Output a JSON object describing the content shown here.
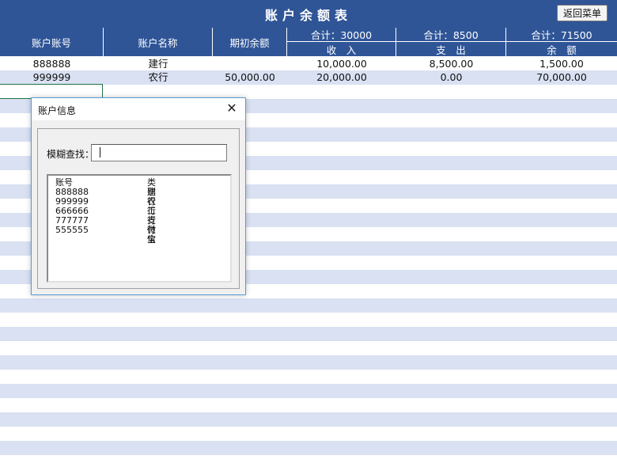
{
  "header": {
    "title": "账户余额表",
    "back_button": "返回菜单"
  },
  "columns": {
    "account_no": "账户账号",
    "account_name": "账户名称",
    "opening_balance": "期初余额",
    "income_total": "合计：30000",
    "income": "收　入",
    "expense_total": "合计：8500",
    "expense": "支　出",
    "balance_total": "合计：71500",
    "balance": "余　额"
  },
  "rows": [
    {
      "account_no": "888888",
      "account_name": "建行",
      "opening_balance": "",
      "income": "10,000.00",
      "expense": "8,500.00",
      "balance": "1,500.00"
    },
    {
      "account_no": "999999",
      "account_name": "农行",
      "opening_balance": "50,000.00",
      "income": "20,000.00",
      "expense": "0.00",
      "balance": "70,000.00"
    }
  ],
  "dialog": {
    "title": "账户信息",
    "search_label": "模糊查找：",
    "search_value": "",
    "list_header": {
      "account_no": "账号",
      "category": "类别"
    },
    "list_items": [
      {
        "account_no": "888888",
        "category": "建行"
      },
      {
        "account_no": "999999",
        "category": "农行"
      },
      {
        "account_no": "666666",
        "category": "工行"
      },
      {
        "account_no": "777777",
        "category": "支付宝"
      },
      {
        "account_no": "555555",
        "category": "微信"
      }
    ]
  },
  "colors": {
    "header_bg": "#2f5597",
    "stripe": "#d9e1f2",
    "dialog_border": "#5b9bd5"
  }
}
